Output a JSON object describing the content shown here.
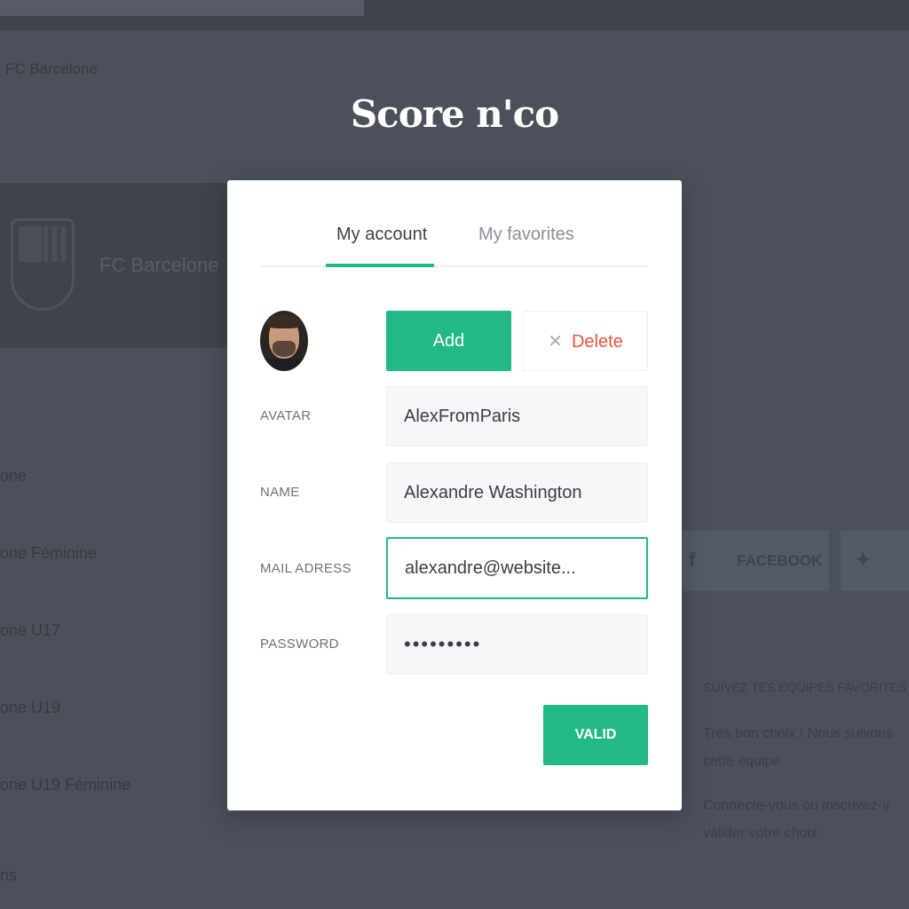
{
  "background": {
    "breadcrumb": "FC Barcelone",
    "team_name": "FC Barcelone",
    "list_items": [
      "one",
      "one Féminine",
      "one U17",
      "one U19",
      "one U19 Féminine",
      "ns"
    ],
    "social": {
      "facebook_label": "FACEBOOK"
    },
    "side_text": [
      "SUIVEZ TES EQUIPES FAVORITES",
      "Très bon choix ! Nous suivons",
      "cette équipe",
      "Connecte-vous ou inscrivez-v",
      "valider votre choix"
    ]
  },
  "app": {
    "title": "Score n'co"
  },
  "modal": {
    "tabs": [
      {
        "label": "My account",
        "active": true
      },
      {
        "label": "My favorites",
        "active": false
      }
    ],
    "avatar_actions": {
      "add_label": "Add",
      "delete_label": "Delete"
    },
    "fields": [
      {
        "label": "AVATAR",
        "value": "AlexFromParis"
      },
      {
        "label": "NAME",
        "value": "Alexandre Washington"
      },
      {
        "label": "MAIL ADRESS",
        "value": "alexandre@website..."
      },
      {
        "label": "PASSWORD",
        "value": "•••••••••"
      }
    ],
    "submit_label": "VALID"
  },
  "colors": {
    "accent": "#22b985",
    "danger": "#e4553d",
    "overlay": "#4b505b"
  },
  "icons": [
    "close-icon",
    "facebook-icon",
    "twitter-icon",
    "club-crest-icon"
  ]
}
